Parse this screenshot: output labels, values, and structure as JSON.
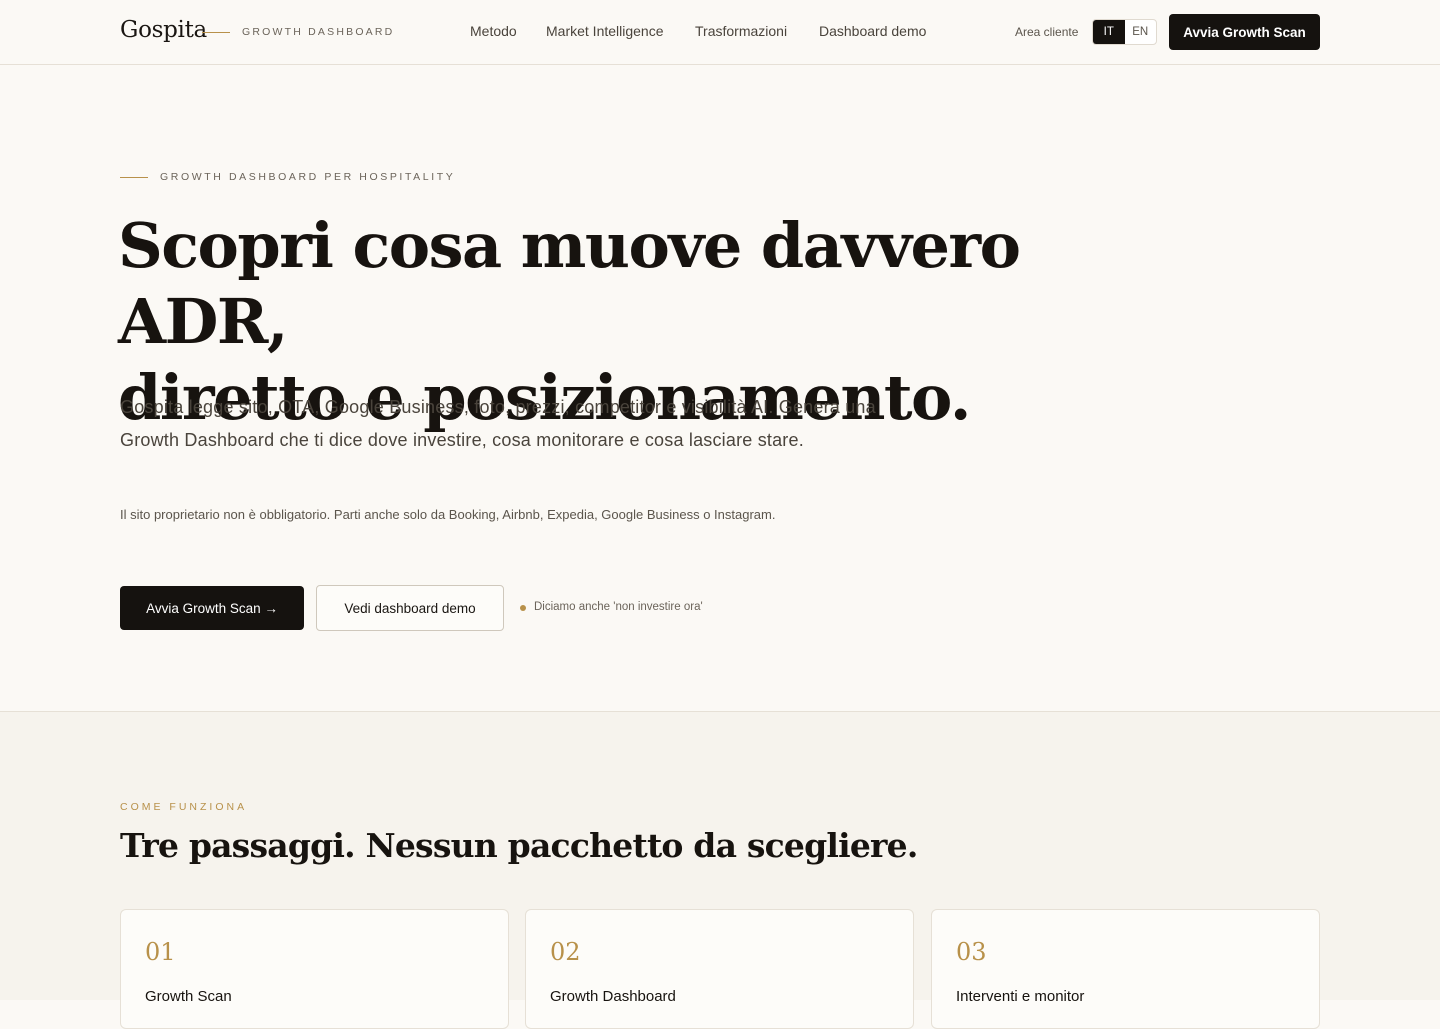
{
  "brand": {
    "name": "Gospita",
    "tagline": "GROWTH DASHBOARD"
  },
  "nav": {
    "items": [
      {
        "label": "Metodo"
      },
      {
        "label": "Market Intelligence"
      },
      {
        "label": "Trasformazioni"
      },
      {
        "label": "Dashboard demo"
      }
    ],
    "client_area": "Area cliente",
    "languages": [
      {
        "code": "IT",
        "active": true
      },
      {
        "code": "EN",
        "active": false
      }
    ],
    "cta": "Avvia Growth Scan"
  },
  "hero": {
    "eyebrow": "GROWTH DASHBOARD PER HOSPITALITY",
    "title_line1": "Scopri cosa muove davvero ADR,",
    "title_line2": "diretto e posizionamento.",
    "lead": "Gospita legge sito, OTA, Google Business, foto, prezzi, competitor e visibilità AI. Genera una Growth Dashboard che ti dice dove investire, cosa monitorare e cosa lasciare stare.",
    "note": "Il sito proprietario non è obbligatorio. Parti anche solo da Booking, Airbnb, Expedia, Google Business o Instagram.",
    "primary_button": "Avvia Growth Scan →",
    "secondary_button": "Vedi dashboard demo",
    "aside_note": "Diciamo anche 'non investire ora'"
  },
  "how_it_works": {
    "eyebrow": "COME FUNZIONA",
    "title": "Tre passaggi. Nessun pacchetto da scegliere.",
    "steps": [
      {
        "number": "01",
        "title": "Growth Scan"
      },
      {
        "number": "02",
        "title": "Growth Dashboard"
      },
      {
        "number": "03",
        "title": "Interventi e monitor"
      }
    ]
  },
  "colors": {
    "accent": "#b8914a",
    "dark": "#15120f",
    "background": "#fbf9f5",
    "section_bg": "#f6f3ed"
  }
}
